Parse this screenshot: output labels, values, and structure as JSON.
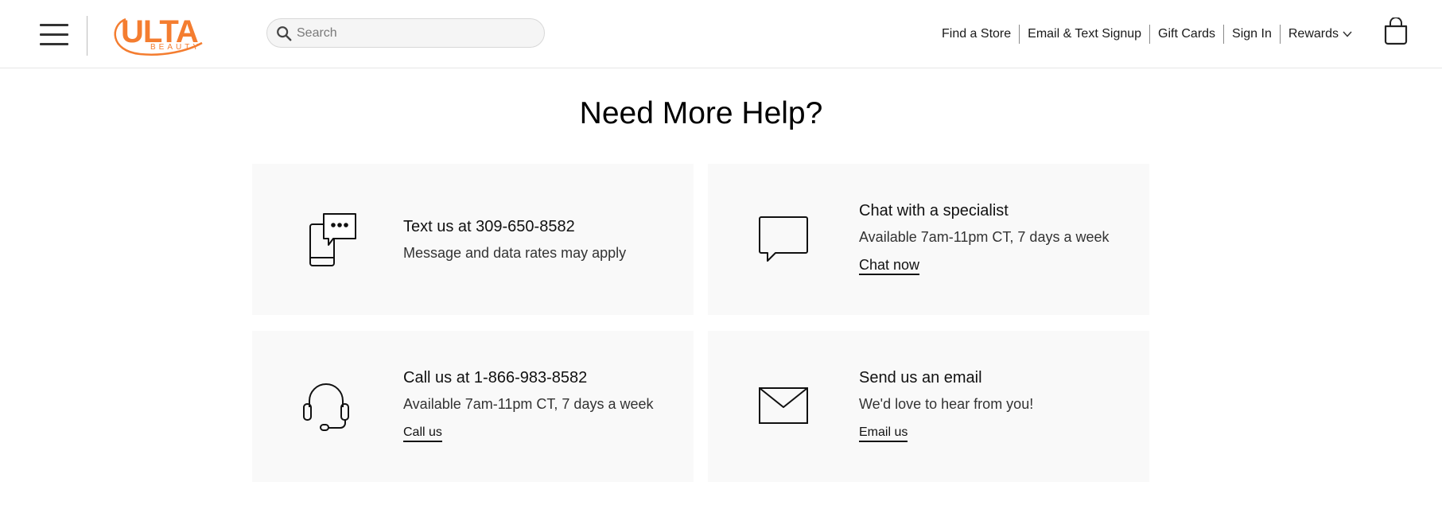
{
  "header": {
    "logo_main": "ULTA",
    "logo_sub": "BEAUTY",
    "search_placeholder": "Search",
    "nav": [
      "Find a Store",
      "Email & Text Signup",
      "Gift Cards",
      "Sign In",
      "Rewards"
    ]
  },
  "main": {
    "title": "Need More Help?",
    "cards": [
      {
        "icon": "phone-text-icon",
        "heading": "Text us at 309-650-8582",
        "text": "Message and data rates may apply",
        "link": ""
      },
      {
        "icon": "chat-bubble-icon",
        "heading": "Chat with a specialist",
        "text": "Available 7am-11pm CT, 7 days a week",
        "link": "Chat now"
      },
      {
        "icon": "headset-icon",
        "heading": "Call us at 1-866-983-8582",
        "text": "Available 7am-11pm CT, 7 days a week",
        "link": "Call us"
      },
      {
        "icon": "envelope-icon",
        "heading": "Send us an email",
        "text": "We'd love to hear from you!",
        "link": "Email us"
      }
    ]
  },
  "colors": {
    "brand": "#f47d30",
    "card_bg": "#f9f9f9",
    "text": "#1a1a1a"
  }
}
